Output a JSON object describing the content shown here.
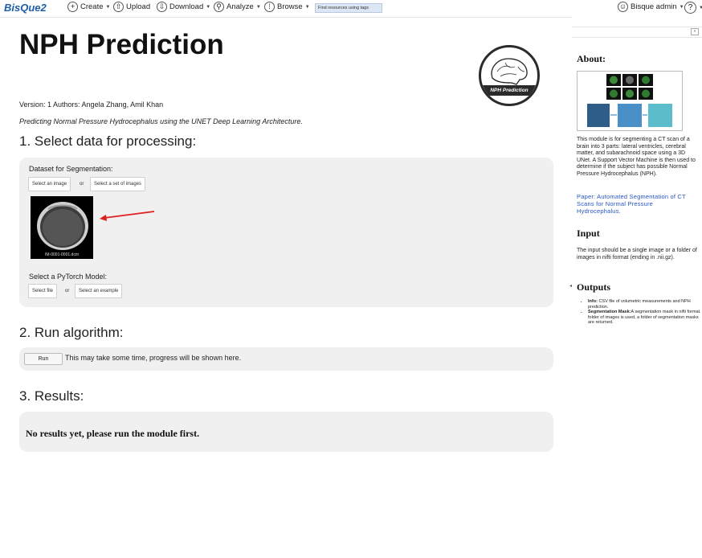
{
  "topbar": {
    "brand": "BisQue2",
    "create": "Create",
    "upload": "Upload",
    "download": "Download",
    "analyze": "Analyze",
    "browse": "Browse",
    "tag_search": "Find resources using tags",
    "user": "Bisque admin",
    "help": "?"
  },
  "module": {
    "title": "NPH Prediction",
    "logo_text": "NPH Prediction",
    "version": "Version: 1 Authors: Angela Zhang, Amil Khan",
    "description": "Predicting Normal Pressure Hydrocephalus using the UNET Deep Learning Architecture."
  },
  "section1": {
    "heading": "1. Select data for processing:",
    "dataset_label": "Dataset for Segmentation:",
    "select_image": "Select an image",
    "or1": "or",
    "select_set": "Select a set of images",
    "thumb_filename": "IM-0001-0001.dcm",
    "model_label": "Select a PyTorch Model:",
    "select_file": "Select file",
    "or2": "or",
    "select_example": "Select an example"
  },
  "section2": {
    "heading": "2. Run algorithm:",
    "run_label": "Run",
    "run_message": "This may take some time, progress will be shown here."
  },
  "section3": {
    "heading": "3. Results:",
    "no_results": "No results yet, please run the module first."
  },
  "sidebar": {
    "collapse_icon": "»",
    "about_heading": "About:",
    "about_text": "This module is for segmenting a CT scan of a brain into 3 parts: lateral ventricles, cerebral matter, and subarachnoid space using a 3D UNet. A Support Vector Machine is then used to determine if the subject has possible Normal Pressure Hydrocephalus (NPH).",
    "paper_link": "Paper: Automated Segmentation of CT Scans for Normal Pressure Hydrocephalus.",
    "input_heading": "Input",
    "input_text": "The input should be a single image or a folder of images in nifti format (ending in .nii.gz).",
    "outputs_heading": "Outputs",
    "outputs": [
      {
        "label": "Info:",
        "text": "CSV file of volumetric measurements and NPH prediction."
      },
      {
        "label": "Segmentation Mask:",
        "text": "A segmentation mask in nifti format. If folder of images is used, a folder of segmentation masks are returned."
      }
    ]
  },
  "colors": {
    "accent_link": "#2455c7",
    "brand": "#1c5ea8",
    "panel_bg": "#f0f0f0",
    "annotation_arrow": "#e02020"
  }
}
